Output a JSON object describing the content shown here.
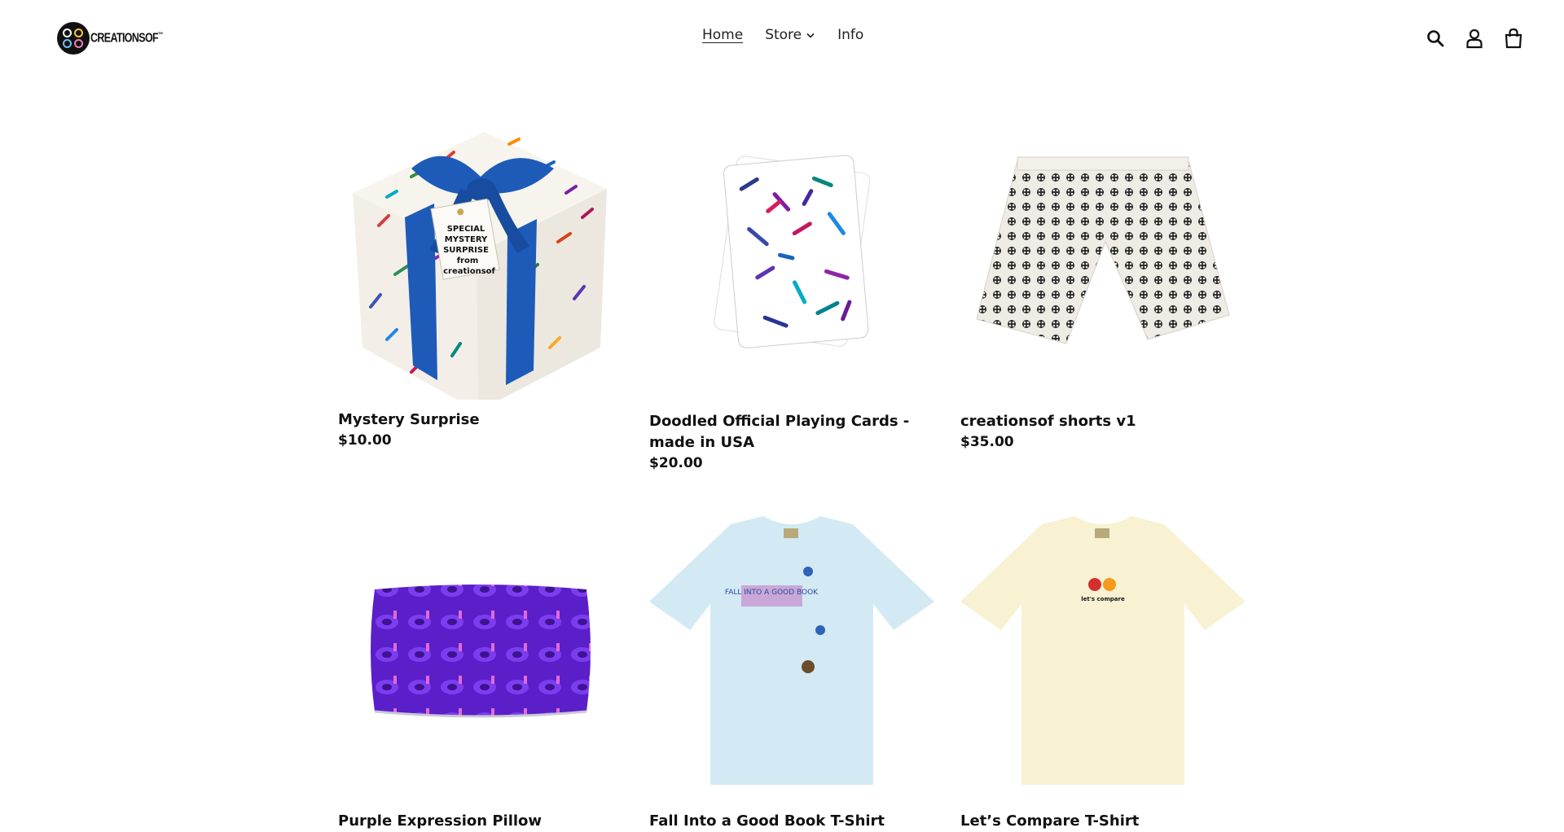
{
  "brand": {
    "name": "CREATIONSOF",
    "trademark": "™"
  },
  "nav": {
    "home": "Home",
    "store": "Store",
    "info": "Info"
  },
  "header_icons": [
    "search-icon",
    "account-icon",
    "cart-icon"
  ],
  "products": [
    {
      "title": "Mystery Surprise",
      "price": "$10.00",
      "tag_text": [
        "SPECIAL",
        "MYSTERY",
        "SURPRISE",
        "from",
        "creationsof"
      ]
    },
    {
      "title": "Doodled Official Playing Cards - made in USA",
      "price": "$20.00"
    },
    {
      "title": "creationsof shorts v1",
      "price": "$35.00"
    },
    {
      "title": "Purple Expression Pillow",
      "price": ""
    },
    {
      "title": "Fall Into a Good Book T-Shirt",
      "price": "",
      "shirt_text": "FALL INTO A GOOD BOOK"
    },
    {
      "title": "Let’s Compare T-Shirt",
      "price": "",
      "shirt_text": "let's compare"
    }
  ],
  "colors": {
    "text": "#111111",
    "ribbon": "#1e5bb8",
    "pillow": "#6a1fd0",
    "tee_blue": "#d3eaf4",
    "tee_cream": "#f8f1d2"
  }
}
